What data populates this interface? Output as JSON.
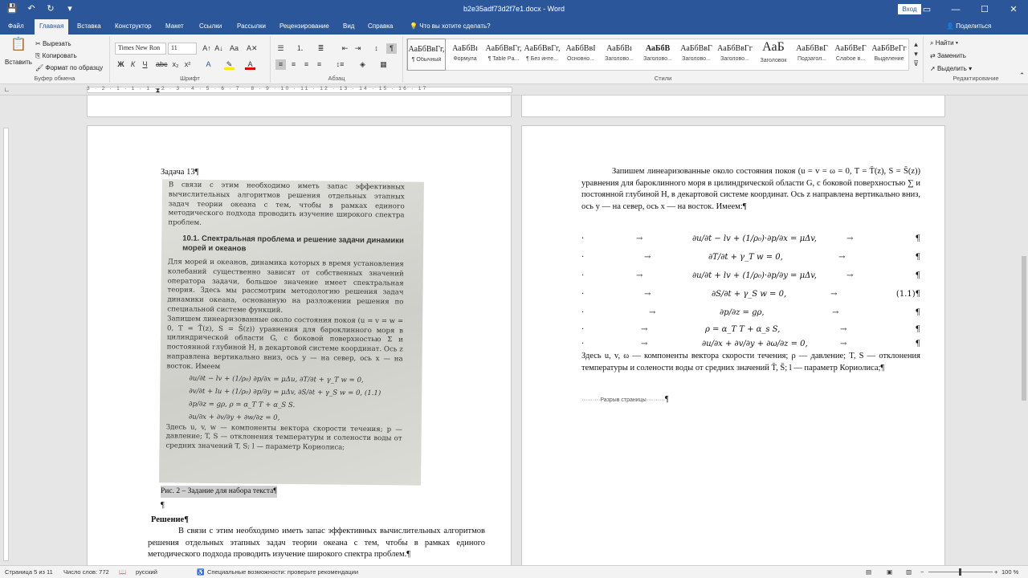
{
  "window": {
    "title": "b2e35adf73d2f7e1.docx - Word",
    "signin_label": "Вход"
  },
  "ribbon_tabs": [
    "Файл",
    "Главная",
    "Вставка",
    "Конструктор",
    "Макет",
    "Ссылки",
    "Рассылки",
    "Рецензирование",
    "Вид",
    "Справка"
  ],
  "tell_me": "Что вы хотите сделать?",
  "share_label": "Поделиться",
  "clipboard": {
    "paste": "Вставить",
    "cut": "Вырезать",
    "copy": "Копировать",
    "format_painter": "Формат по образцу",
    "group": "Буфер обмена"
  },
  "font": {
    "name": "Times New Ron",
    "size": "11",
    "group": "Шрифт"
  },
  "paragraph_group": "Абзац",
  "styles_group": "Стили",
  "styles": [
    {
      "sample": "АаБбВвГг,",
      "name": "¶ Обычный"
    },
    {
      "sample": "АаБбВı",
      "name": "Формула"
    },
    {
      "sample": "АаБбВвГг,",
      "name": "¶ Table Pa..."
    },
    {
      "sample": "АаБбВвГг,",
      "name": "¶ Без инте..."
    },
    {
      "sample": "АаБбВвI",
      "name": "Основно..."
    },
    {
      "sample": "АаБбВı",
      "name": "Заголово..."
    },
    {
      "sample": "АаБбВ",
      "name": "Заголово..."
    },
    {
      "sample": "АаБбВвГ",
      "name": "Заголово..."
    },
    {
      "sample": "АаБбВвГг",
      "name": "Заголово..."
    },
    {
      "sample": "АаБ",
      "name": "Заголовок"
    },
    {
      "sample": "АаБбВвГ",
      "name": "Подзагол..."
    },
    {
      "sample": "АаБбВеГ",
      "name": "Слабое в..."
    },
    {
      "sample": "АаБбВеГг",
      "name": "Выделение"
    }
  ],
  "editing": {
    "find": "Найти",
    "replace": "Заменить",
    "select": "Выделить",
    "group": "Редактирование"
  },
  "ruler_numbers": "3 · 2 · 1 · 1 · 1 · 2 · 3 · 4 · 5 · 6 · 7 · 8 · 9 · 10 · 11 · 12 · 13 · 14 · 15 · 16 · 17",
  "left_page": {
    "heading": "Задача 13¶",
    "caption": "Рис. 2 – Задание для набора текста¶",
    "empty_para": "¶",
    "solution_title": "Решение¶",
    "solution_text": "В связи с этим необходимо иметь запас эффективных вычислительных алгоритмов решения отдельных этапных задач теории океана с тем, чтобы в рамках единого методического подхода проводить изучение широкого спектра проблем.¶",
    "photo": {
      "p1": "В связи с этим необходимо иметь запас эффективных вычислительных алгоритмов решения отдельных этапных задач теории океана с тем, чтобы в рамках единого методического подхода проводить изучение широкого спектра проблем.",
      "section": "10.1. Спектральная проблема и решение задачи динамики морей и океанов",
      "p2": "Для морей и океанов, динамика которых в время установления колебаний существенно зависят от собственных значений оператора задачи, большое значение имеет спектральная теория. Здесь мы рассмотрим методологию решения задач динамики океана, основанную на разложении решения по специальной системе функций.",
      "p3": "Запишем линеаризованные около состояния покоя (u = v = w = 0, T = T̄(z), S = S̄(z)) уравнения для бароклинного моря в цилиндрической области G, с боковой поверхностью Σ и постоянной глубиной H, в декартовой системе координат. Ось z направлена вертикально вниз, ось y — на север, ось x — на восток. Имеем",
      "eq1": "∂u/∂t − lv + (1/ρ₀) ∂p/∂x = μΔu,        ∂T/∂t + γ_T w = 0,",
      "eq2": "∂v/∂t + lu + (1/ρ₀) ∂p/∂y = μΔv,        ∂S/∂t + γ_S w = 0,        (1.1)",
      "eq3": "∂p/∂z = gρ,                                ρ = α_T T + α_S S.",
      "eq4": "∂u/∂x + ∂v/∂y + ∂w/∂z = 0,",
      "p4": "Здесь u, v, w — компоненты вектора скорости течения; p — давление; T, S — отклонения температуры и солености воды от средних значений T, S; l — параметр Кориолиса;"
    }
  },
  "right_page": {
    "intro": "Запишем линеаризованные около состояния покоя (u = v = ω = 0, T = T̄(z), S = S̄(z)) уравнения для бароклинного моря в цилиндрической области G, с боковой поверхностью ∑ и постоянной глубиной H, в декартовой системе координат. Ось z направлена вертикально вниз, ось y — на север, ось x — на восток. Имеем:¶",
    "equations": [
      {
        "expr": "∂u/∂t − lv + (1/ρ₀)·∂p/∂x = μΔv,",
        "num": "¶"
      },
      {
        "expr": "∂T/∂t + γ_T w = 0,",
        "num": "¶"
      },
      {
        "expr": "∂u/∂t + lv + (1/ρ₀)·∂p/∂y = μΔv,",
        "num": "¶"
      },
      {
        "expr": "∂S/∂t + γ_S w = 0,",
        "num": "(1.1)¶"
      },
      {
        "expr": "∂p/∂z = gρ,",
        "num": "¶"
      },
      {
        "expr": "ρ = α_T T + α_s S,",
        "num": "¶"
      },
      {
        "expr": "∂u/∂x + ∂v/∂y + ∂ω/∂z = 0,",
        "num": "¶"
      }
    ],
    "closing": "Здесь u, v, ω — компоненты вектора скорости течения; ρ — давление; T, S — отклонения температуры и солености воды от средних значений T̄, S̄; l — параметр Кориолиса;¶",
    "page_break": "Разрыв страницы"
  },
  "status": {
    "page": "Страница 5 из 11",
    "words": "Число слов: 772",
    "language": "русский",
    "accessibility": "Специальные возможности: проверьте рекомендации",
    "zoom": "100 %"
  },
  "colors": {
    "accent": "#2b579a",
    "ribbon": "#f3f3f3",
    "canvas": "#e6e6e6"
  }
}
